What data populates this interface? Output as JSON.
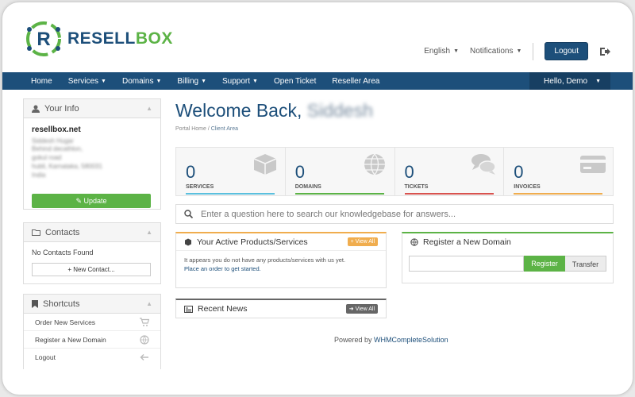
{
  "brand": {
    "name_part1": "RESELL",
    "name_part2": "BOX"
  },
  "top_links": {
    "language": "English",
    "notifications": "Notifications",
    "logout": "Logout"
  },
  "nav": {
    "items": [
      "Home",
      "Services",
      "Domains",
      "Billing",
      "Support",
      "Open Ticket",
      "Reseller Area"
    ],
    "has_dropdown": [
      false,
      true,
      true,
      true,
      true,
      false,
      false
    ],
    "user": "Hello, Demo"
  },
  "your_info": {
    "title": "Your Info",
    "company": "resellbox.net",
    "lines": [
      "Siddesh Hugar",
      "Behind decathlon,",
      "gokul road",
      "hubli, Karnataka, 580031",
      "India"
    ],
    "update_label": "Update"
  },
  "contacts": {
    "title": "Contacts",
    "empty_text": "No Contacts Found",
    "new_contact_label": "New Contact..."
  },
  "shortcuts": {
    "title": "Shortcuts",
    "items": [
      {
        "label": "Order New Services",
        "icon": "cart-icon"
      },
      {
        "label": "Register a New Domain",
        "icon": "globe-icon"
      },
      {
        "label": "Logout",
        "icon": "arrow-left-icon"
      }
    ]
  },
  "welcome": {
    "prefix": "Welcome Back,",
    "name": "Siddesh"
  },
  "breadcrumb": {
    "home": "Portal Home",
    "separator": "/",
    "current": "Client Area"
  },
  "stats": [
    {
      "value": "0",
      "label": "SERVICES",
      "icon": "cube-icon",
      "color": "#5bc0de"
    },
    {
      "value": "0",
      "label": "DOMAINS",
      "icon": "globe-icon",
      "color": "#5cb346"
    },
    {
      "value": "0",
      "label": "TICKETS",
      "icon": "chat-icon",
      "color": "#d9534f"
    },
    {
      "value": "0",
      "label": "INVOICES",
      "icon": "card-icon",
      "color": "#f0ad4e"
    }
  ],
  "search": {
    "placeholder": "Enter a question here to search our knowledgebase for answers..."
  },
  "products_card": {
    "title": "Your Active Products/Services",
    "view_all": "+ View All",
    "text": "It appears you do not have any products/services with us yet.",
    "link": "Place an order to get started.",
    "accent": "#f0ad4e"
  },
  "domain_card": {
    "title": "Register a New Domain",
    "register": "Register",
    "transfer": "Transfer",
    "accent": "#5cb346"
  },
  "news_card": {
    "title": "Recent News",
    "view_all": "View All",
    "accent": "#666666"
  },
  "footer": {
    "prefix": "Powered by",
    "link": "WHMCompleteSolution"
  },
  "colors": {
    "brand_blue": "#1d4f7a",
    "brand_green": "#5cb346"
  }
}
